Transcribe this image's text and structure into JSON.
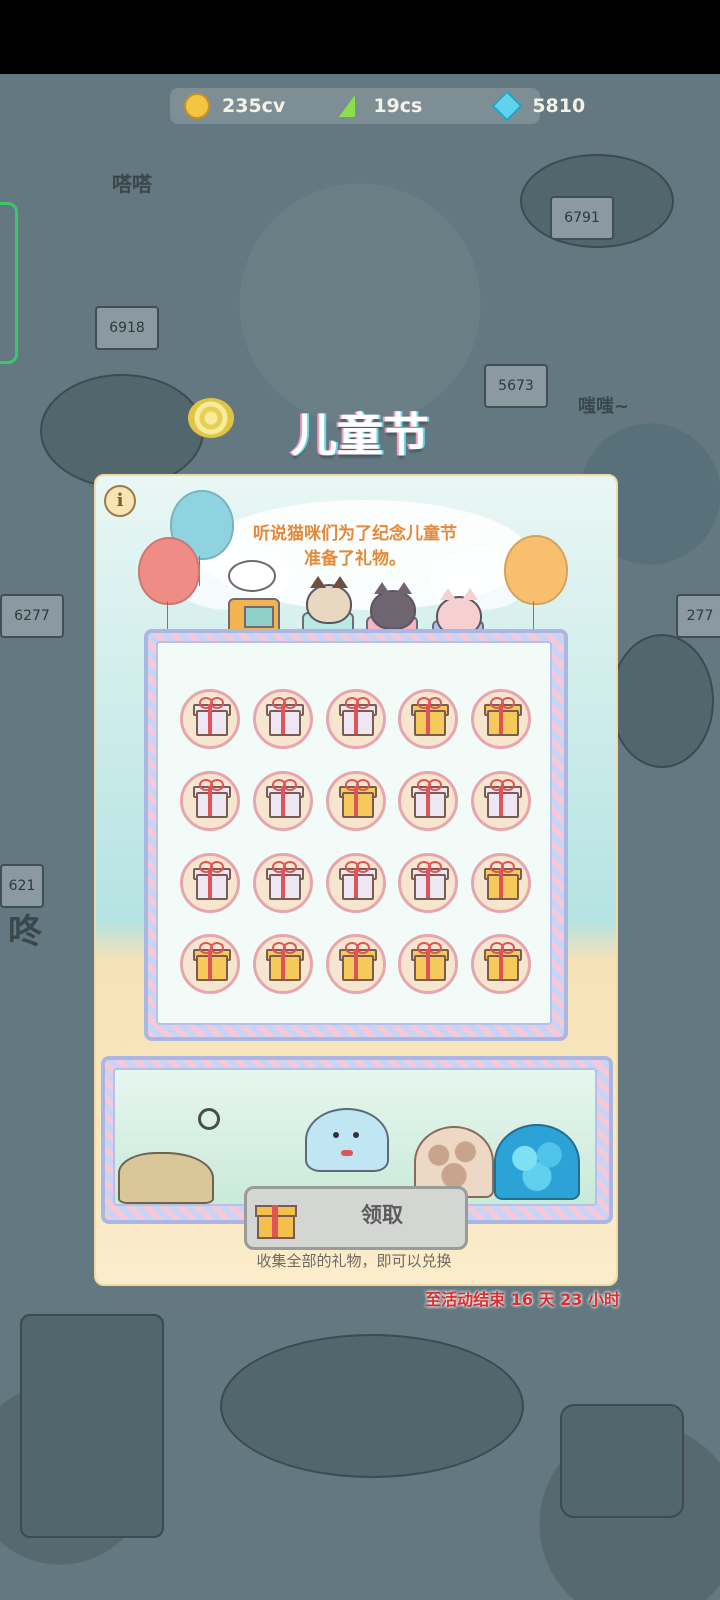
{
  "resources": {
    "coins": "235cv",
    "energy": "19cs",
    "gems": "5810"
  },
  "background": {
    "signs": [
      "6791",
      "6918",
      "5673",
      "6277",
      "277",
      "621"
    ],
    "sounds": [
      "嗒嗒",
      "嗤嗤~",
      "咚"
    ]
  },
  "event": {
    "title": "儿童节",
    "info_symbol": "i",
    "story_line1": "听说猫咪们为了纪念儿童节",
    "story_line2": "准备了礼物。"
  },
  "gift_grid": {
    "rows": [
      [
        "pale",
        "pale",
        "pale",
        "gold",
        "gold"
      ],
      [
        "pale",
        "pale",
        "gold",
        "pale",
        "pale"
      ],
      [
        "pale",
        "pale",
        "pale",
        "pale",
        "gold"
      ],
      [
        "gold",
        "gold",
        "gold",
        "gold",
        "gold"
      ]
    ]
  },
  "claim": {
    "button_label": "领取",
    "hint": "收集全部的礼物，即可以兑换"
  },
  "countdown": {
    "prefix": "至活动结束",
    "days": "16",
    "days_unit": "天",
    "hours": "23",
    "hours_unit": "小时"
  },
  "colors": {
    "gift_gold": "#f5c95a",
    "gift_pale": "#eee6f3",
    "countdown_red": "#d92f2f",
    "story_orange": "#e4893a"
  }
}
